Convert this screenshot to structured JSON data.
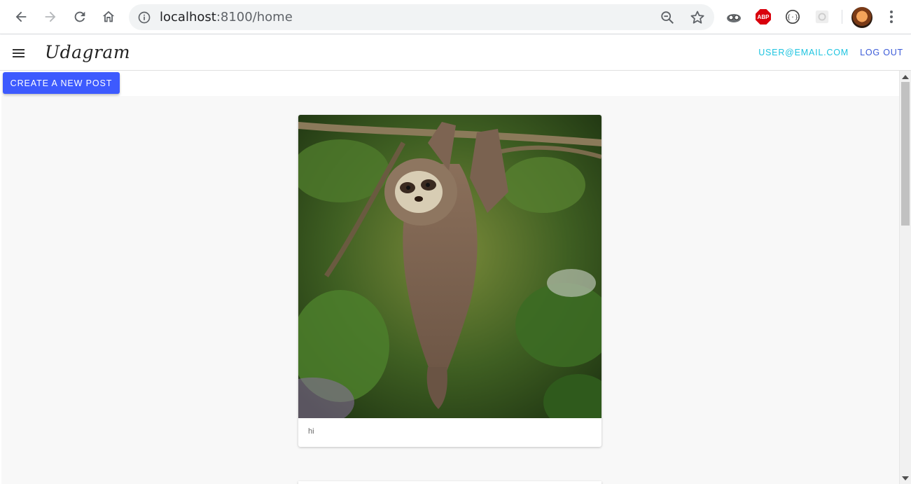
{
  "browser": {
    "url_host": "localhost",
    "url_rest": ":8100/home",
    "extensions": {
      "abp_label": "ABP"
    }
  },
  "app": {
    "brand": "Udagram",
    "user_email": "USER@EMAIL.COM",
    "logout_label": "LOG OUT",
    "create_post_label": "CREATE A NEW POST"
  },
  "feed": {
    "posts": [
      {
        "caption": "hi",
        "image_subject": "sloth hanging from branch"
      }
    ]
  },
  "colors": {
    "primary_button": "#3d5afe",
    "email_link": "#1ec4e0",
    "logout_link": "#3b5bd8",
    "abp_red": "#d9000c"
  }
}
